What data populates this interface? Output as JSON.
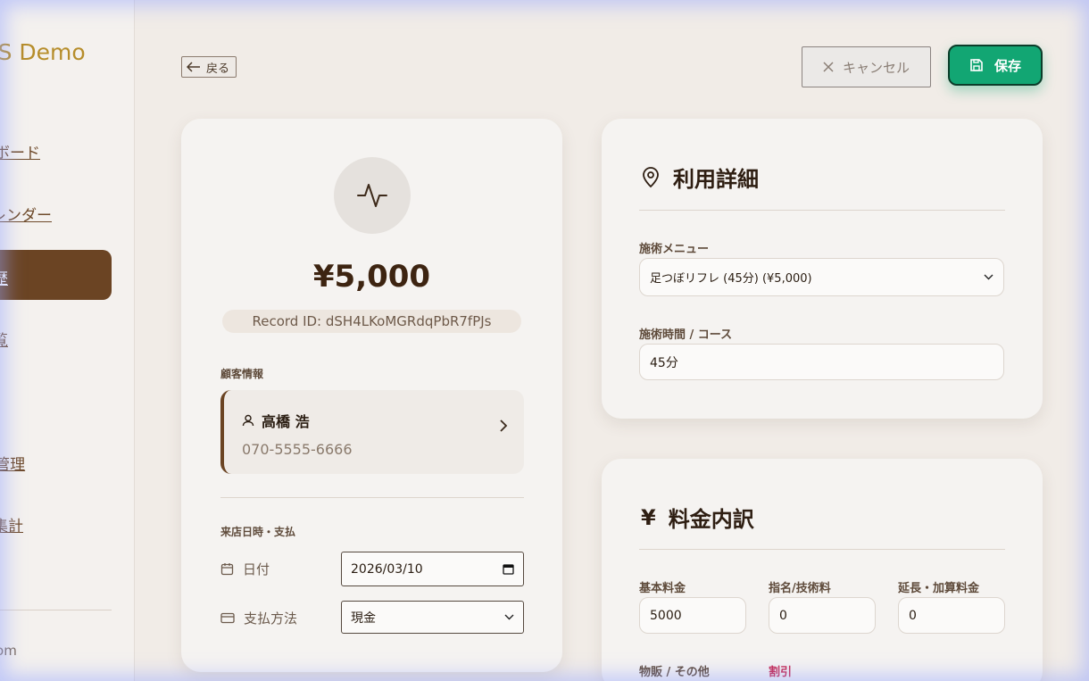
{
  "sidebar": {
    "brand": "MS Demo",
    "items": [
      {
        "label": "ボード"
      },
      {
        "label": "レンダー"
      },
      {
        "label": "歴",
        "active": true
      },
      {
        "label": "覧"
      },
      {
        "label": "-管理"
      },
      {
        "label": "集計"
      }
    ],
    "email": ".com"
  },
  "topbar": {
    "back_label": "戻る",
    "cancel_label": "キャンセル",
    "save_label": "保存"
  },
  "record": {
    "amount": "¥5,000",
    "record_id": "Record ID: dSH4LKoMGRdqPbR7fPJs",
    "customer_section_label": "顧客情報",
    "customer_name": "高橋 浩",
    "customer_phone": "070-5555-6666",
    "visit_section_label": "来店日時・支払",
    "date_label": "日付",
    "date_value": "2026/03/10",
    "payment_label": "支払方法",
    "payment_value": "現金"
  },
  "usage": {
    "title": "利用詳細",
    "menu_label": "施術メニュー",
    "menu_value": "足つぼリフレ (45分) (¥5,000)",
    "time_label": "施術時間 / コース",
    "time_value": "45分"
  },
  "price": {
    "title": "料金内訳",
    "currency_symbol": "¥",
    "base_label": "基本料金",
    "base_value": "5000",
    "nomination_label": "指名/技術料",
    "nomination_value": "0",
    "extension_label": "延長・加算料金",
    "extension_value": "0",
    "goods_label": "物販 / その他",
    "discount_label": "割引"
  },
  "colors": {
    "accent_brown": "#6b4423",
    "save_green": "#12a673",
    "brand_gold": "#b68d2a",
    "discount_red": "#c7254e"
  }
}
